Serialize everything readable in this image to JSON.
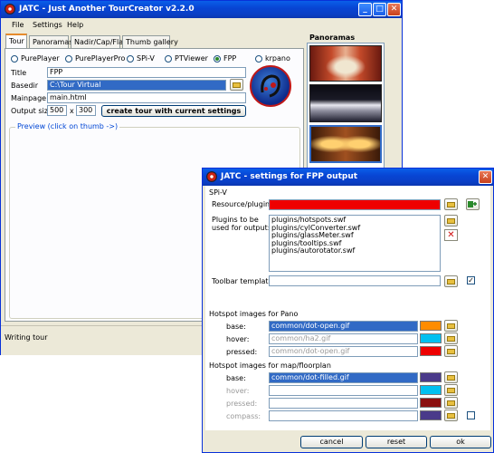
{
  "main": {
    "title": "JATC - Just Another TourCreator v2.2.0",
    "menu": [
      "File",
      "Settings",
      "Help"
    ],
    "tabs": [
      "Tour",
      "Panoramas",
      "Nadir/Cap/Flat",
      "Thumb gallery"
    ],
    "players": [
      "PurePlayer",
      "PurePlayerPro",
      "SPi-V",
      "PTViewer",
      "FPP",
      "krpano"
    ],
    "selected_player": "FPP",
    "title_label": "Title",
    "title_value": "FPP",
    "basedir_label": "Basedir",
    "basedir_value": "C:\\Tour Virtual",
    "mainpage_label": "Mainpage",
    "mainpage_value": "main.html",
    "output_size_label": "Output size",
    "output_width": "500",
    "output_x": "x",
    "output_height": "300",
    "create_button": "create tour with current settings",
    "preview_legend": "Preview  (click on thumb ->)",
    "panoramas_header": "Panoramas",
    "status": "Writing tour"
  },
  "dialog": {
    "title": "JATC - settings for FPP output",
    "group": "SPi-V",
    "resource_label": "Resource/plugin:",
    "plugins_label_1": "Plugins to be",
    "plugins_label_2": "used for output:",
    "plugins": [
      "plugins/hotspots.swf",
      "plugins/cylConverter.swf",
      "plugins/glassMeter.swf",
      "plugins/tooltips.swf",
      "plugins/autorotator.swf"
    ],
    "toolbar_label": "Toolbar template:",
    "hotspot_pano_header": "Hotspot images for Pano",
    "base_label": "base:",
    "hover_label": "hover:",
    "pressed_label": "pressed:",
    "pano_base": "common/dot-open.gif",
    "pano_hover": "common/ha2.gif",
    "pano_pressed": "common/dot-open.gif",
    "hotspot_map_header": "Hotspot images for map/floorplan",
    "compass_label": "compass:",
    "map_base": "common/dot-filled.gif",
    "buttons": {
      "cancel": "cancel",
      "reset": "reset",
      "ok": "ok"
    },
    "colors": {
      "resource": "#ee0000",
      "pano_base": "#ff8c00",
      "pano_hover": "#00c0f0",
      "pano_pressed": "#ee0000",
      "map_base": "#4a3a8a",
      "map_hover": "#00c0f0",
      "map_pressed": "#8b1010",
      "map_compass": "#4a3a8a"
    }
  }
}
